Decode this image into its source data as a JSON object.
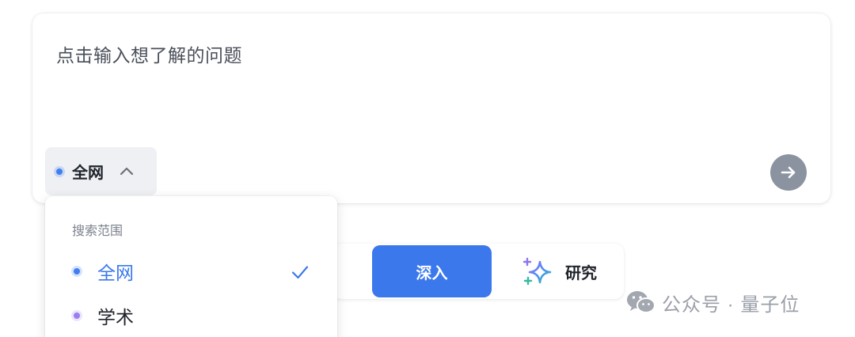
{
  "input": {
    "placeholder": "点击输入想了解的问题"
  },
  "scope_chip": {
    "label": "全网",
    "icon": "chevron-up-icon"
  },
  "send_button": {
    "icon": "arrow-right-icon"
  },
  "mode_toggle": {
    "deep_label": "深入",
    "research_label": "研究",
    "research_icon": "sparkle-icon",
    "selected": "深入"
  },
  "dropdown": {
    "title": "搜索范围",
    "options": [
      {
        "label": "全网",
        "selected": true
      },
      {
        "label": "学术",
        "selected": false
      }
    ]
  },
  "watermark": {
    "text": "公众号 · 量子位",
    "icon": "wechat-icon"
  },
  "colors": {
    "accent": "#3b78ec",
    "academic_dot": "#9b7df0",
    "send_button": "#8b93a1",
    "chip_bg": "#eef0f3",
    "muted_text": "#7b818c"
  }
}
